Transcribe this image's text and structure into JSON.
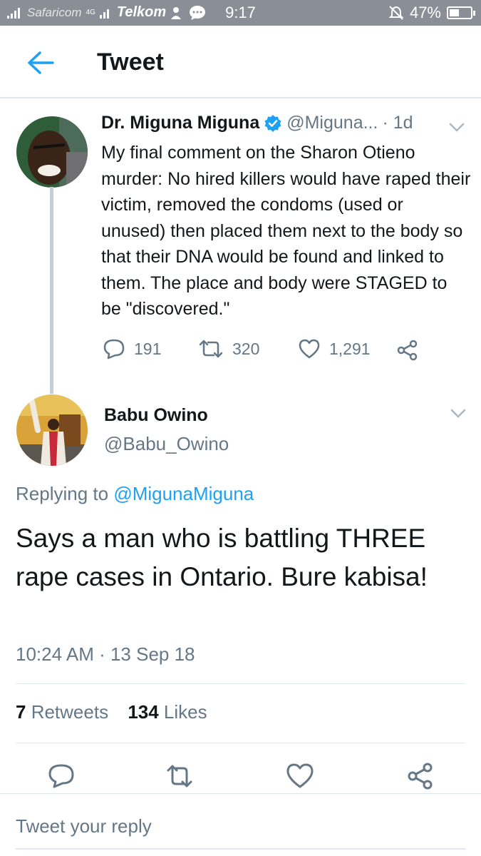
{
  "status_bar": {
    "carrier1": "Safaricom",
    "network": "4G",
    "carrier2": "Telkom",
    "time": "9:17",
    "battery": "47%",
    "battery_level": 0.47
  },
  "header": {
    "title": "Tweet"
  },
  "parent_tweet": {
    "name": "Dr. Miguna Miguna",
    "handle": "@Miguna...",
    "age": "· 1d",
    "text": "My final comment on the Sharon Otieno murder: No hired killers would have raped their victim, removed the condoms (used or unused) then placed them next to the body so that their DNA would be found and linked to them. The place and body were STAGED to be \"discovered.\"",
    "replies": "191",
    "retweets": "320",
    "likes": "1,291"
  },
  "main_tweet": {
    "name": "Babu Owino",
    "handle": "@Babu_Owino",
    "replying_prefix": "Replying to ",
    "replying_to": "@MigunaMiguna",
    "text": "Says a man who is battling THREE rape cases in Ontario. Bure kabisa!",
    "timestamp": "10:24 AM · 13 Sep 18",
    "retweet_count": "7",
    "retweet_label": " Retweets",
    "like_count": "134",
    "like_label": " Likes"
  },
  "reply": {
    "placeholder": "Tweet your reply"
  },
  "colors": {
    "accent": "#1da1f2",
    "muted": "#657786",
    "text": "#14171a",
    "statusbar": "#8a8f97"
  }
}
